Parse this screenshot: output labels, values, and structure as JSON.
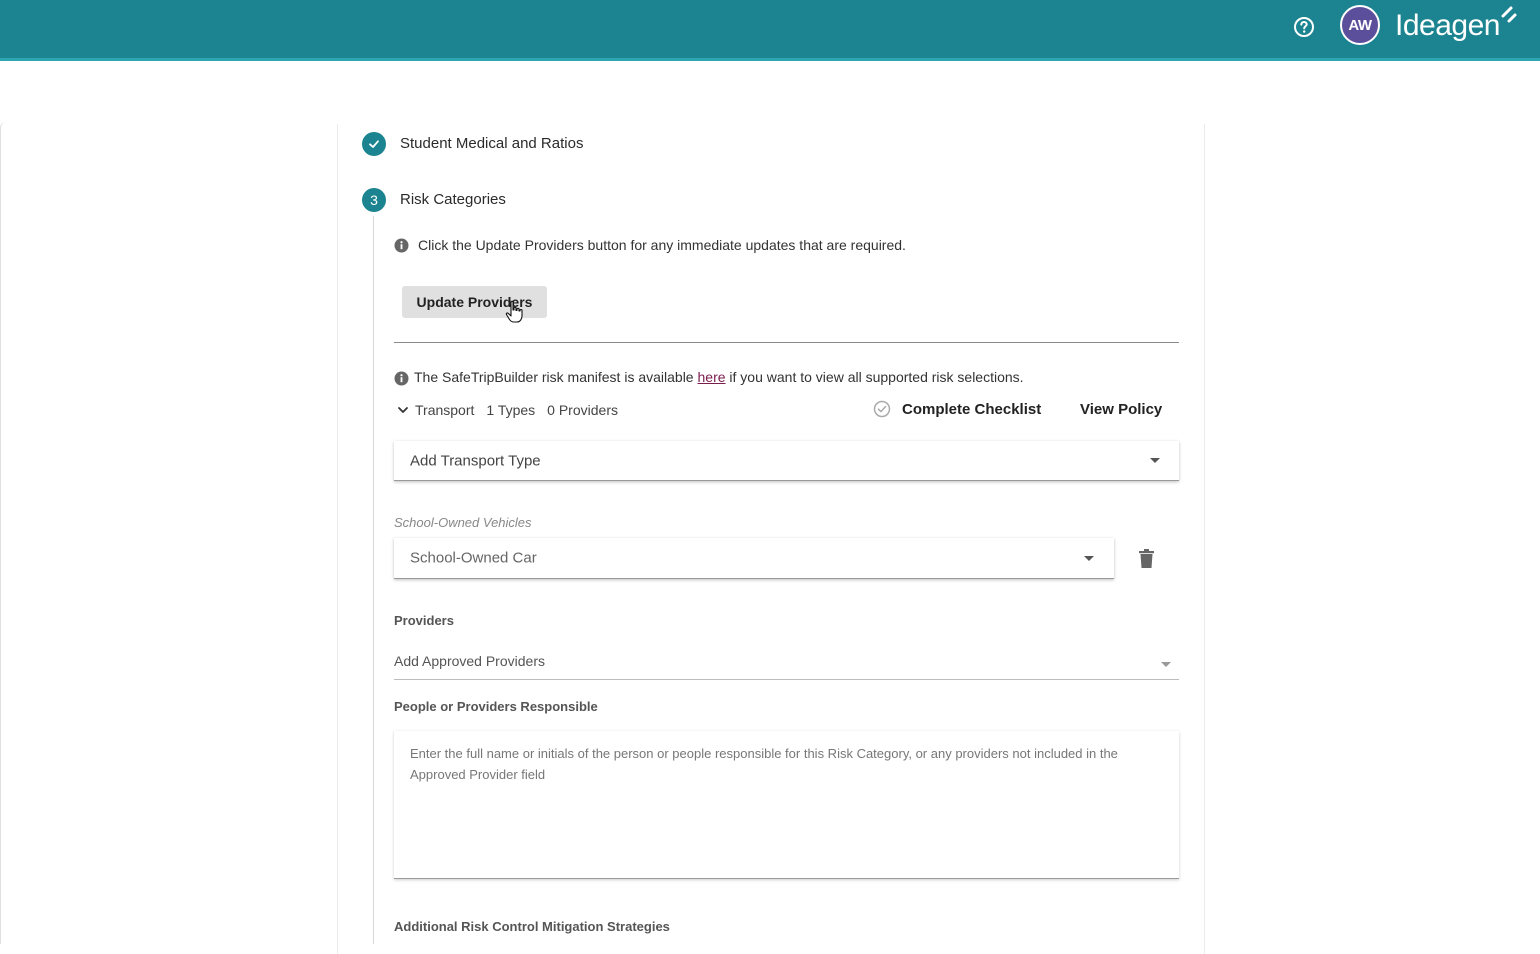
{
  "header": {
    "logo_text": "Ideagen",
    "avatar_initials": "AW",
    "help_icon": "question-circle-icon",
    "brand_color": "#1b8490"
  },
  "steps": [
    {
      "title": "Student Medical and Ratios",
      "status": "complete",
      "icon": "check-icon"
    },
    {
      "number": "3",
      "title": "Risk Categories",
      "status": "active"
    }
  ],
  "risk_categories": {
    "info_update": "Click the Update Providers button for any immediate updates that are required.",
    "update_button": "Update Providers",
    "manifest_prefix": "The SafeTripBuilder risk manifest is available ",
    "manifest_link": "here",
    "manifest_suffix": " if you want to view all supported risk selections.",
    "transport": {
      "label": "Transport",
      "types": "1 Types",
      "providers": "0 Providers",
      "complete_checklist": "Complete Checklist",
      "view_policy": "View Policy",
      "add_type_placeholder": "Add Transport Type",
      "vehicle_caption": "School-Owned Vehicles",
      "vehicle_value": "School-Owned Car",
      "providers_label": "Providers",
      "providers_placeholder": "Add Approved Providers",
      "responsible_label": "People or Providers Responsible",
      "responsible_placeholder": "Enter the full name or initials of the person or people responsible for this Risk Category, or any providers not included in the Approved Provider field",
      "mitigation_label": "Additional Risk Control Mitigation Strategies"
    }
  }
}
